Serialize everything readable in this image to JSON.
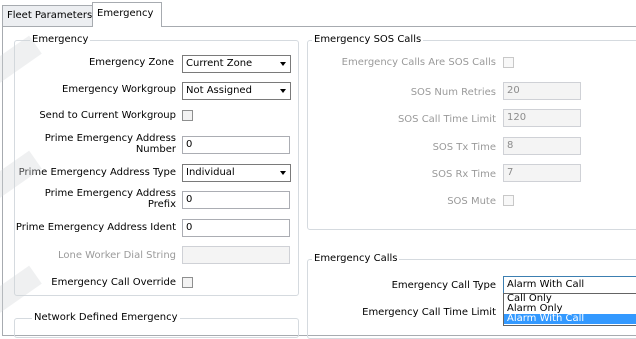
{
  "tabs": [
    {
      "label": "Fleet Parameters"
    },
    {
      "label": "Emergency"
    }
  ],
  "emergency_group": {
    "title": "Emergency",
    "zone": {
      "label": "Emergency Zone",
      "value": "Current Zone"
    },
    "workgroup": {
      "label": "Emergency Workgroup",
      "value": "Not Assigned"
    },
    "send_current": {
      "label": "Send to Current Workgroup"
    },
    "prime_number": {
      "label": "Prime Emergency Address Number",
      "value": "0"
    },
    "prime_type": {
      "label": "Prime Emergency Address Type",
      "value": "Individual"
    },
    "prime_prefix": {
      "label": "Prime Emergency Address Prefix",
      "value": "0"
    },
    "prime_ident": {
      "label": "Prime Emergency Address Ident",
      "value": "0"
    },
    "lone_worker": {
      "label": "Lone Worker Dial String",
      "value": ""
    },
    "call_override": {
      "label": "Emergency Call Override"
    }
  },
  "network_group": {
    "title": "Network Defined Emergency"
  },
  "sos_group": {
    "title": "Emergency SOS Calls",
    "are_sos": {
      "label": "Emergency Calls Are SOS Calls"
    },
    "num_retries": {
      "label": "SOS Num Retries",
      "value": "20"
    },
    "time_limit": {
      "label": "SOS Call Time Limit",
      "value": "120"
    },
    "tx_time": {
      "label": "SOS Tx Time",
      "value": "8"
    },
    "rx_time": {
      "label": "SOS Rx Time",
      "value": "7"
    },
    "mute": {
      "label": "SOS Mute"
    }
  },
  "calls_group": {
    "title": "Emergency Calls",
    "call_type": {
      "label": "Emergency Call Type",
      "value": "Alarm With Call",
      "options": [
        "Call Only",
        "Alarm Only",
        "Alarm With Call"
      ]
    },
    "time_limit": {
      "label": "Emergency Call Time Limit"
    }
  }
}
